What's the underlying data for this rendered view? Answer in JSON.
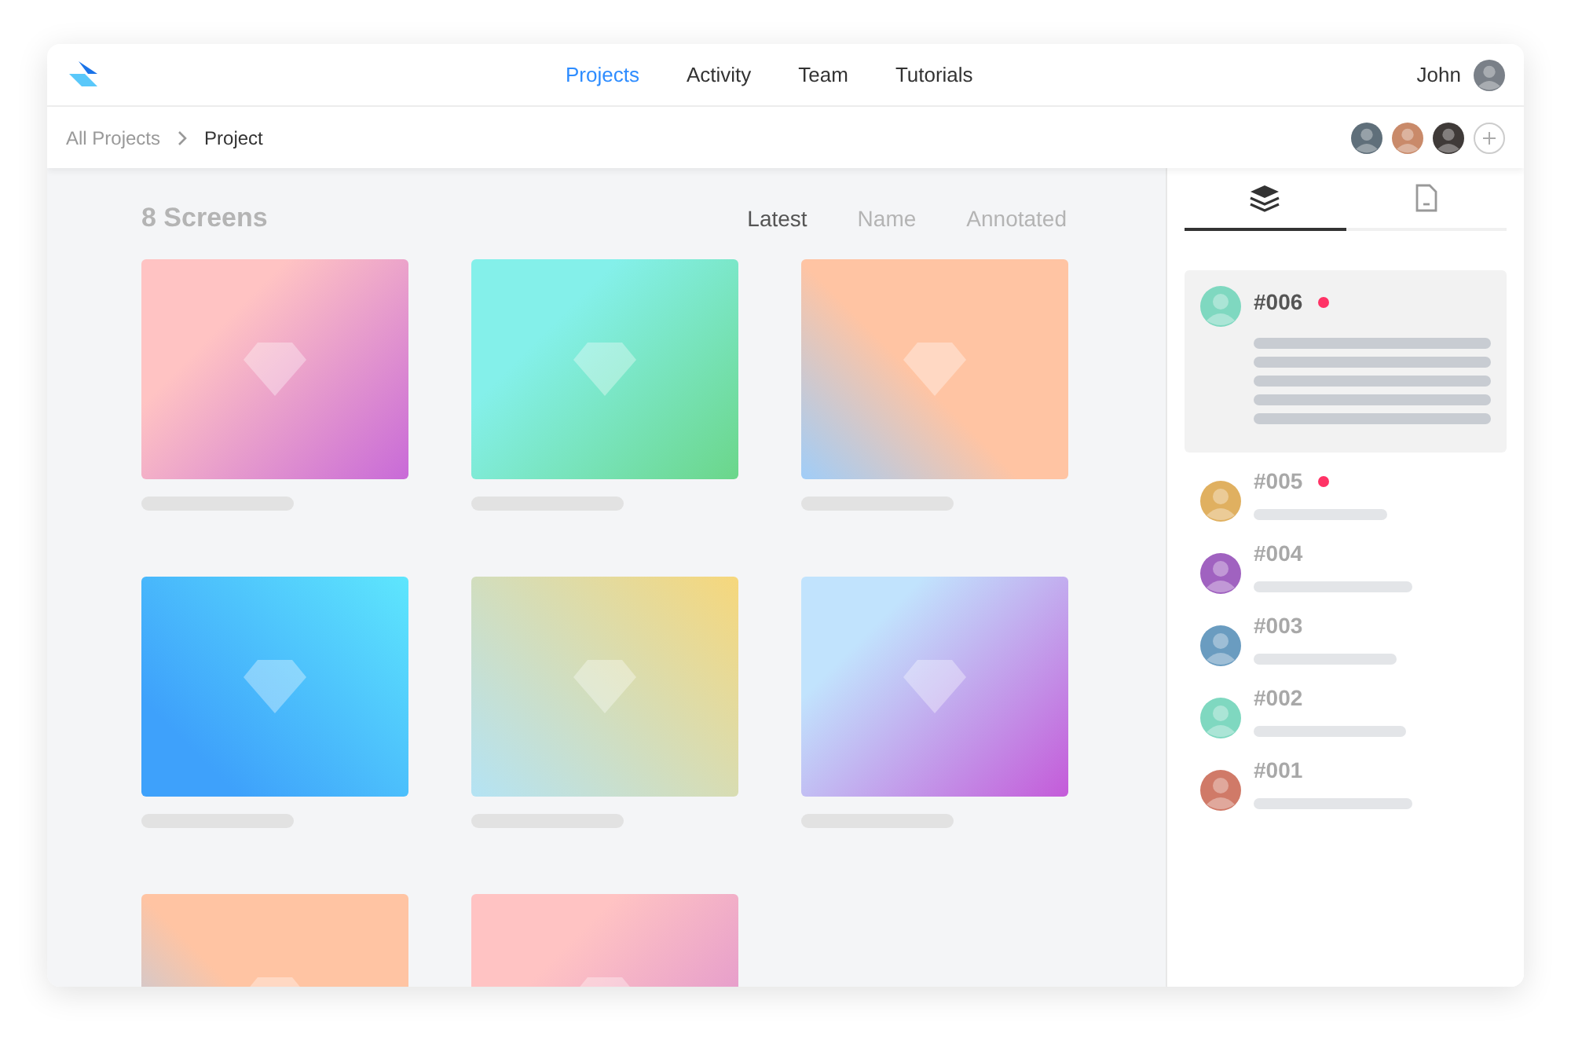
{
  "nav": [
    {
      "label": "Projects",
      "selected": true
    },
    {
      "label": "Activity",
      "selected": false
    },
    {
      "label": "Team",
      "selected": false
    },
    {
      "label": "Tutorials",
      "selected": false
    }
  ],
  "user": {
    "name": "John"
  },
  "breadcrumb": [
    "All Projects",
    "Project"
  ],
  "collaborators": [
    {
      "color": "#5f6f7a"
    },
    {
      "color": "#c98a6a"
    },
    {
      "color": "#3f3a38"
    }
  ],
  "title": "8 Screens",
  "sort": [
    {
      "label": "Latest",
      "selected": true
    },
    {
      "label": "Name",
      "selected": false
    },
    {
      "label": "Annotated",
      "selected": false
    }
  ],
  "screens": [
    {
      "kind": "picture"
    },
    {
      "kind": "picture"
    },
    {
      "kind": "picture"
    },
    {
      "kind": "picture"
    },
    {
      "kind": "picture"
    },
    {
      "kind": "picture"
    },
    {
      "kind": "picture"
    },
    {
      "kind": "picture"
    }
  ],
  "side_tabs": [
    {
      "kind": "layers",
      "selected": true
    },
    {
      "kind": "document",
      "selected": false
    }
  ],
  "comments": [
    {
      "id": "#006",
      "unread": true,
      "selected": true,
      "color": "#7fd8c0"
    },
    {
      "id": "#005",
      "unread": true,
      "selected": false,
      "color": "#e0b060"
    },
    {
      "id": "#004",
      "unread": false,
      "selected": false,
      "color": "#a062c0"
    },
    {
      "id": "#003",
      "unread": false,
      "selected": false,
      "color": "#6a9cc0"
    },
    {
      "id": "#002",
      "unread": false,
      "selected": false,
      "color": "#7fd8c0"
    },
    {
      "id": "#001",
      "unread": false,
      "selected": false,
      "color": "#d07a68"
    }
  ]
}
